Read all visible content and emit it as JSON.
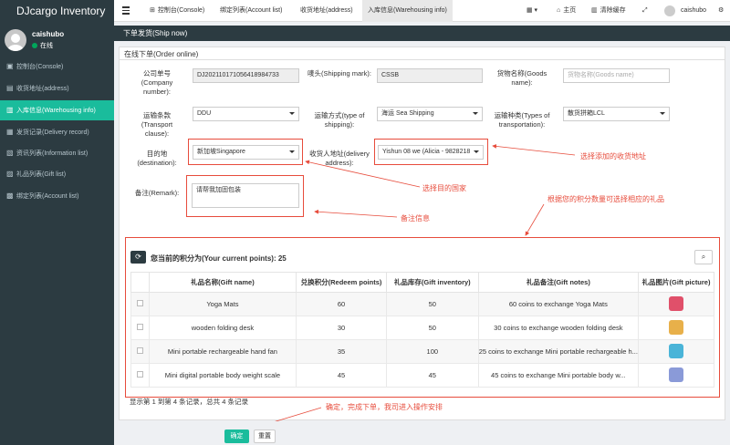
{
  "app": {
    "title": "DJcargo Inventory"
  },
  "user": {
    "name": "caishubo",
    "status": "在线"
  },
  "sidebar": {
    "items": [
      {
        "icon": "dashboard-icon",
        "label": "控制台(Console)"
      },
      {
        "icon": "address-icon",
        "label": "收货地址(address)"
      },
      {
        "icon": "warehousing-icon",
        "label": "入库信息(Warehousing info)",
        "active": true
      },
      {
        "icon": "delivery-icon",
        "label": "发货记录(Delivery record)"
      },
      {
        "icon": "information-icon",
        "label": "资讯列表(Information list)"
      },
      {
        "icon": "gift-icon",
        "label": "礼品列表(Gift list)"
      },
      {
        "icon": "account-icon",
        "label": "绑定列表(Account list)"
      }
    ]
  },
  "topbar": {
    "tabs": [
      {
        "label": "控制台(Console)",
        "icon": "dashboard-icon"
      },
      {
        "label": "绑定列表(Account list)"
      },
      {
        "label": "收货地址(address)"
      },
      {
        "label": "入库信息(Warehousing info)",
        "active": true
      }
    ],
    "home": "主页",
    "clear_cache": "清除缓存",
    "user": "caishubo"
  },
  "page": {
    "header": "下单发货(Ship now)",
    "section": "在线下单(Order online)"
  },
  "form": {
    "order_no": {
      "label": "公司单号(Company number):",
      "value": "DJ2021101710564189847​33"
    },
    "shipping_mark": {
      "label": "唛头(Shipping mark):",
      "value": "CSSB"
    },
    "goods_name": {
      "label": "货物名称(Goods name):",
      "placeholder": "货物名称(Goods name)"
    },
    "clause": {
      "label": "运输条款(Transport clause):",
      "value": "DDU"
    },
    "ship_type": {
      "label": "运输方式(type of shipping):",
      "value": "海运 Sea Shipping"
    },
    "transport_type": {
      "label": "运输种类(Types of transportation):",
      "value": "散货拼箱LCL"
    },
    "destination": {
      "label": "目的地(destination):",
      "value": "新加坡Singapore"
    },
    "delivery_address": {
      "label": "收货人地址(delivery address):",
      "value": "Yishun 08 we    (Alicia - 9828218"
    },
    "remark": {
      "label": "备注(Remark):",
      "value": "请帮我加固包装"
    }
  },
  "annotations": {
    "address": "选择添加的收货地址",
    "destination": "选择目的国家",
    "remark": "备注信息",
    "gift": "根据您的积分数量可选择相应的礼品",
    "confirm": "确定，完成下单，我司进入操作安排"
  },
  "gifts": {
    "points_label": "您当前的积分为(Your current points):",
    "points": "25",
    "columns": [
      "礼品名称(Gift name)",
      "兑换积分(Redeem points)",
      "礼品库存(Gift inventory)",
      "礼品备注(Gift notes)",
      "礼品图片(Gift picture)"
    ],
    "rows": [
      {
        "name": "Yoga Mats",
        "points": "60",
        "inventory": "50",
        "notes": "60 coins to exchange Yoga Mats",
        "pic_color": "#e0506a"
      },
      {
        "name": "wooden folding desk",
        "points": "30",
        "inventory": "50",
        "notes": "30 coins to exchange wooden folding desk",
        "pic_color": "#e8b04a"
      },
      {
        "name": "Mini portable rechargeable hand fan",
        "points": "35",
        "inventory": "100",
        "notes": "25 coins to exchange Mini portable rechargeable h...",
        "pic_color": "#4ab4d8"
      },
      {
        "name": "Mini digital portable body weight scale",
        "points": "45",
        "inventory": "45",
        "notes": "45 coins to exchange Mini portable body w...",
        "pic_color": "#8a9ad8"
      }
    ],
    "page_info": "显示第 1 到第 4 条记录，总共 4 条记录"
  },
  "buttons": {
    "confirm": "确定",
    "reset": "重置"
  }
}
